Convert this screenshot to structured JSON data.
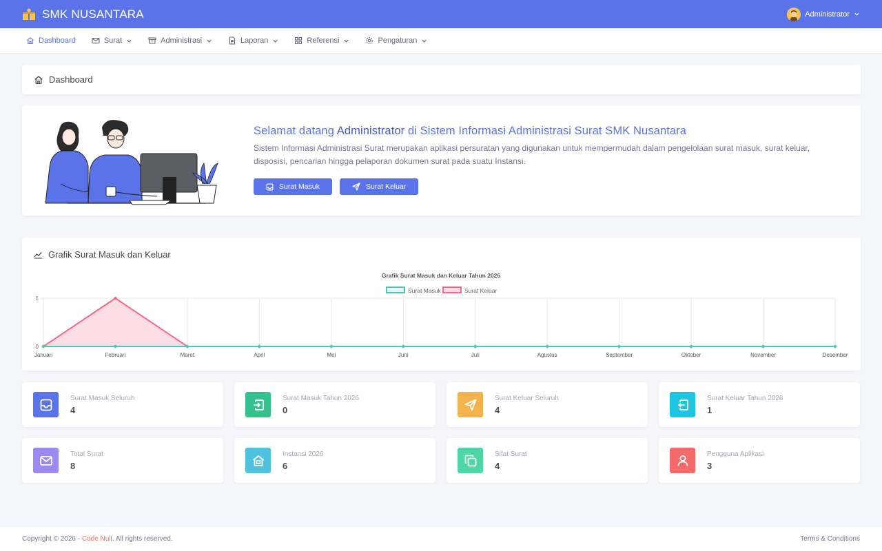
{
  "app": {
    "title": "SMK NUSANTARA"
  },
  "user": {
    "name": "Administrator"
  },
  "nav": [
    {
      "label": "Dashboard",
      "icon": "home-icon"
    },
    {
      "label": "Surat",
      "icon": "mail-icon"
    },
    {
      "label": "Administrasi",
      "icon": "archive-icon"
    },
    {
      "label": "Laporan",
      "icon": "file-text-icon"
    },
    {
      "label": "Referensi",
      "icon": "grid-icon"
    },
    {
      "label": "Pengaturan",
      "icon": "settings-icon"
    }
  ],
  "breadcrumb": {
    "title": "Dashboard"
  },
  "welcome": {
    "pre": "Selamat datang",
    "name": "Administrator",
    "mid": "di",
    "app": "Sistem Informasi Administrasi Surat SMK Nusantara",
    "description": "Sistem Informasi Administrasi Surat merupakan aplikasi persuratan yang digunakan untuk mempermudah dalam pengelolaan surat masuk, surat keluar, disposisi, pencarian hingga pelaporan dokumen surat pada suatu Instansi.",
    "btn_masuk": "Surat Masuk",
    "btn_keluar": "Surat Keluar"
  },
  "chart_card": {
    "header": "Grafik Surat Masuk dan Keluar"
  },
  "chart_data": {
    "type": "line",
    "title": "Grafik Surat Masuk dan Keluar Tahun 2026",
    "categories": [
      "Januari",
      "Februari",
      "Maret",
      "April",
      "Mei",
      "Juni",
      "Juli",
      "Agustus",
      "September",
      "Oktober",
      "November",
      "Desember"
    ],
    "series": [
      {
        "name": "Surat Masuk",
        "color": "#4fc7b8",
        "values": [
          0,
          0,
          0,
          0,
          0,
          0,
          0,
          0,
          0,
          0,
          0,
          0
        ]
      },
      {
        "name": "Surat Keluar",
        "color": "#f46a8a",
        "fill": "#fcdde3",
        "values": [
          0,
          1,
          0,
          0,
          0,
          0,
          0,
          0,
          0,
          0,
          0,
          0
        ]
      }
    ],
    "ylim": [
      0,
      1
    ],
    "yticks": [
      "0",
      "1"
    ],
    "legend": "top-center",
    "grid": true
  },
  "stats": [
    {
      "label": "Surat Masuk Seluruh",
      "value": "4",
      "color": "#5b73e8",
      "icon": "inbox-icon"
    },
    {
      "label": "Surat Masuk Tahun 2026",
      "value": "0",
      "color": "#34c38f",
      "icon": "sign-in-icon"
    },
    {
      "label": "Surat Keluar Seluruh",
      "value": "4",
      "color": "#f1b44c",
      "icon": "send-icon"
    },
    {
      "label": "Surat Keluar Tahun 2026",
      "value": "1",
      "color": "#1ec5e3",
      "icon": "sign-out-icon"
    },
    {
      "label": "Total Surat",
      "value": "8",
      "color": "#9d8af0",
      "icon": "envelope-icon"
    },
    {
      "label": "Instansi 2026",
      "value": "6",
      "color": "#4fc2e0",
      "icon": "building-icon"
    },
    {
      "label": "Sifat Surat",
      "value": "4",
      "color": "#4fd6a7",
      "icon": "copy-icon"
    },
    {
      "label": "Pengguna Aplikasi",
      "value": "3",
      "color": "#f46a6a",
      "icon": "user-icon"
    }
  ],
  "footer": {
    "copyright": "Copyright © 2026 - ",
    "author": "Code Null",
    "rights": ". All rights reserved.",
    "terms": "Terms & Conditions"
  }
}
